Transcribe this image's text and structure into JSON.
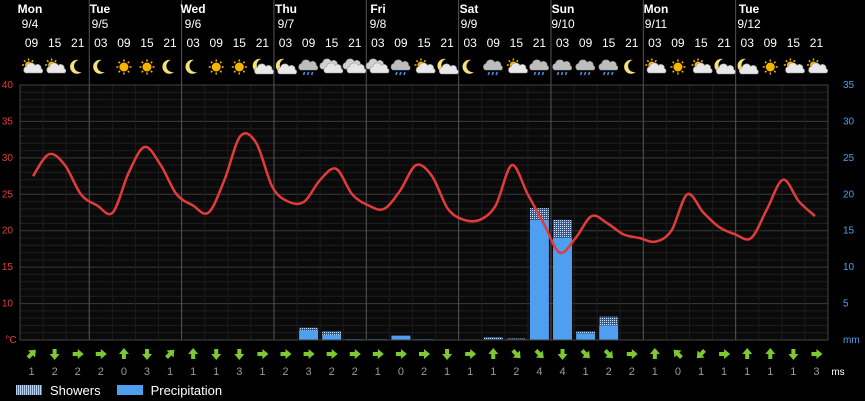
{
  "chart_data": {
    "type": "line",
    "days": [
      {
        "name": "Mon",
        "date": "9/4"
      },
      {
        "name": "Tue",
        "date": "9/5"
      },
      {
        "name": "Wed",
        "date": "9/6"
      },
      {
        "name": "Thu",
        "date": "9/7"
      },
      {
        "name": "Fri",
        "date": "9/8"
      },
      {
        "name": "Sat",
        "date": "9/9"
      },
      {
        "name": "Sun",
        "date": "9/10"
      },
      {
        "name": "Mon",
        "date": "9/11"
      },
      {
        "name": "Tue",
        "date": "9/12"
      }
    ],
    "hours": [
      "09",
      "15",
      "21",
      "03",
      "09",
      "15",
      "21",
      "03",
      "09",
      "15",
      "21",
      "03",
      "09",
      "15",
      "21",
      "03",
      "09",
      "15",
      "21",
      "03",
      "09",
      "15",
      "21",
      "03",
      "09",
      "15",
      "21",
      "03",
      "09",
      "15",
      "21",
      "03",
      "09",
      "15",
      "21"
    ],
    "weather_icons": [
      "sun-cloud",
      "sun-cloud",
      "moon",
      "moon",
      "sun",
      "sun",
      "moon",
      "moon",
      "sun",
      "sun",
      "moon-cloud",
      "moon-cloud",
      "cloud-rain",
      "cloud",
      "cloud",
      "cloud",
      "cloud-rain",
      "sun-cloud",
      "moon-cloud",
      "moon",
      "cloud-rain",
      "sun-cloud",
      "cloud-rain",
      "cloud-rain",
      "cloud-rain",
      "cloud-rain",
      "moon",
      "sun-cloud",
      "sun",
      "sun-cloud",
      "moon-cloud",
      "moon-cloud",
      "sun",
      "sun-cloud",
      "sun-cloud"
    ],
    "temperature": [
      27.5,
      30.5,
      29,
      25,
      23.5,
      22.5,
      28,
      31.5,
      29,
      25,
      23.5,
      22.5,
      27,
      33,
      32,
      26,
      24,
      24,
      27,
      28.5,
      25,
      23.5,
      23,
      25.5,
      29,
      27.5,
      23,
      21.5,
      21.5,
      23.5,
      29,
      25,
      21,
      17,
      19,
      22,
      21,
      19.5,
      19,
      18.5,
      20,
      25,
      22.5,
      20.5,
      19.5,
      19,
      23,
      27,
      24,
      22
    ],
    "precipitation": [
      0,
      0,
      0,
      0,
      0,
      0,
      0,
      0,
      0,
      0,
      0,
      0,
      1.3,
      0.7,
      0.1,
      0.1,
      0.6,
      0.1,
      0,
      0,
      0.1,
      0.1,
      16.5,
      14,
      0.9,
      2,
      0,
      0,
      0,
      0,
      0,
      0,
      0,
      0,
      0
    ],
    "showers": [
      0,
      0,
      0,
      0,
      0,
      0,
      0,
      0,
      0,
      0,
      0,
      0,
      0.4,
      0.5,
      0,
      0,
      0,
      0,
      0,
      0,
      0.3,
      0.1,
      1.6,
      2.5,
      0.3,
      1.2,
      0,
      0,
      0,
      0,
      0,
      0,
      0,
      0,
      0
    ],
    "wind_dir": [
      "ne",
      "s",
      "e",
      "e",
      "n",
      "s",
      "ne",
      "n",
      "s",
      "s",
      "e",
      "e",
      "e",
      "e",
      "e",
      "e",
      "e",
      "e",
      "s",
      "e",
      "n",
      "se",
      "se",
      "s",
      "se",
      "se",
      "e",
      "n",
      "nw",
      "sw",
      "e",
      "n",
      "n",
      "s",
      "e"
    ],
    "wind_speed": [
      "1",
      "2",
      "2",
      "2",
      "0",
      "3",
      "1",
      "1",
      "1",
      "3",
      "1",
      "2",
      "3",
      "2",
      "2",
      "1",
      "0",
      "2",
      "1",
      "1",
      "1",
      "2",
      "4",
      "4",
      "1",
      "2",
      "2",
      "1",
      "0",
      "1",
      "1",
      "1",
      "1",
      "1",
      "3"
    ],
    "y_left": {
      "min": 5,
      "max": 40,
      "ticks": [
        "40",
        "35",
        "30",
        "25",
        "20",
        "15",
        "10"
      ],
      "unit": "°C"
    },
    "y_right": {
      "min": 0,
      "max": 35,
      "ticks": [
        "35",
        "30",
        "25",
        "20",
        "15",
        "10",
        "5"
      ],
      "unit": "mm"
    },
    "wind_unit": "ms",
    "legend": {
      "showers": "Showers",
      "precipitation": "Precipitation"
    },
    "colors": {
      "temperature": "#e23b3b",
      "precipitation": "#4f9ff0",
      "left_axis": "#e23b3b",
      "right_axis": "#4f9ff0",
      "wind_arrow": "#7ec832"
    }
  }
}
